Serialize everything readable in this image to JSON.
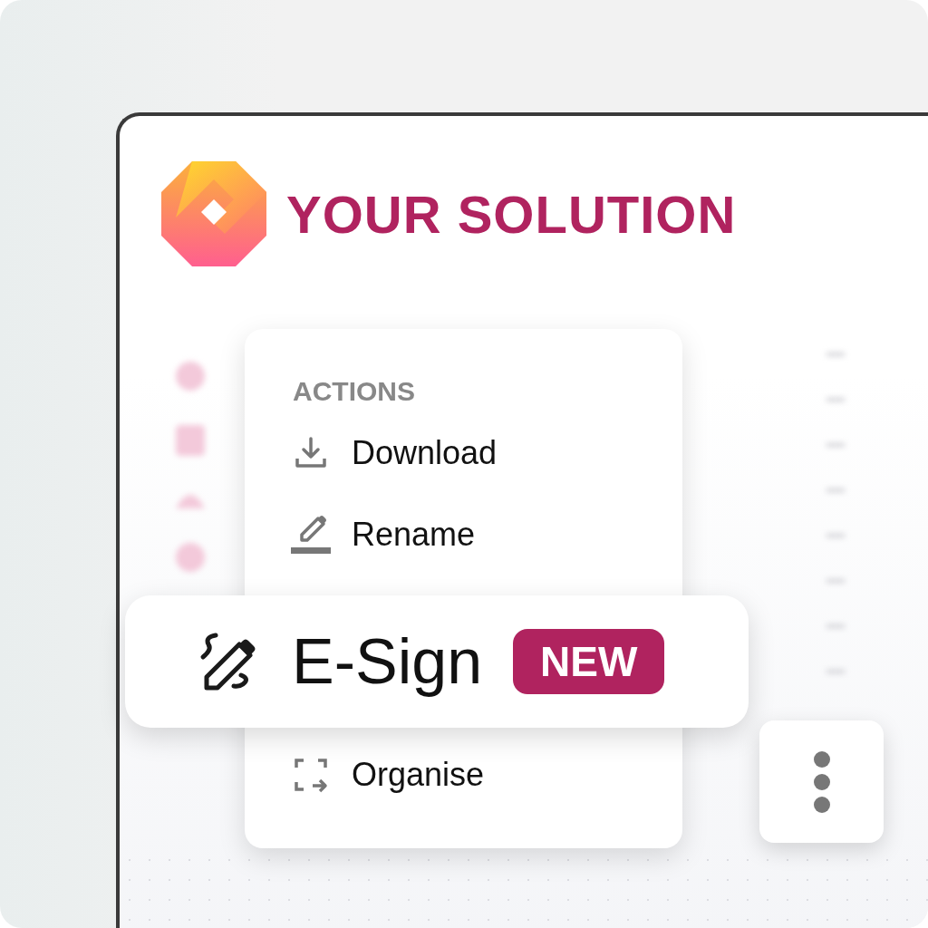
{
  "app": {
    "title": "YOUR SOLUTION"
  },
  "menu": {
    "heading": "ACTIONS",
    "items": [
      {
        "label": "Download",
        "kind": "download"
      },
      {
        "label": "Rename",
        "kind": "rename"
      },
      {
        "label": "Organise",
        "kind": "organise"
      }
    ]
  },
  "highlight": {
    "label": "E-Sign",
    "badge": "NEW"
  }
}
